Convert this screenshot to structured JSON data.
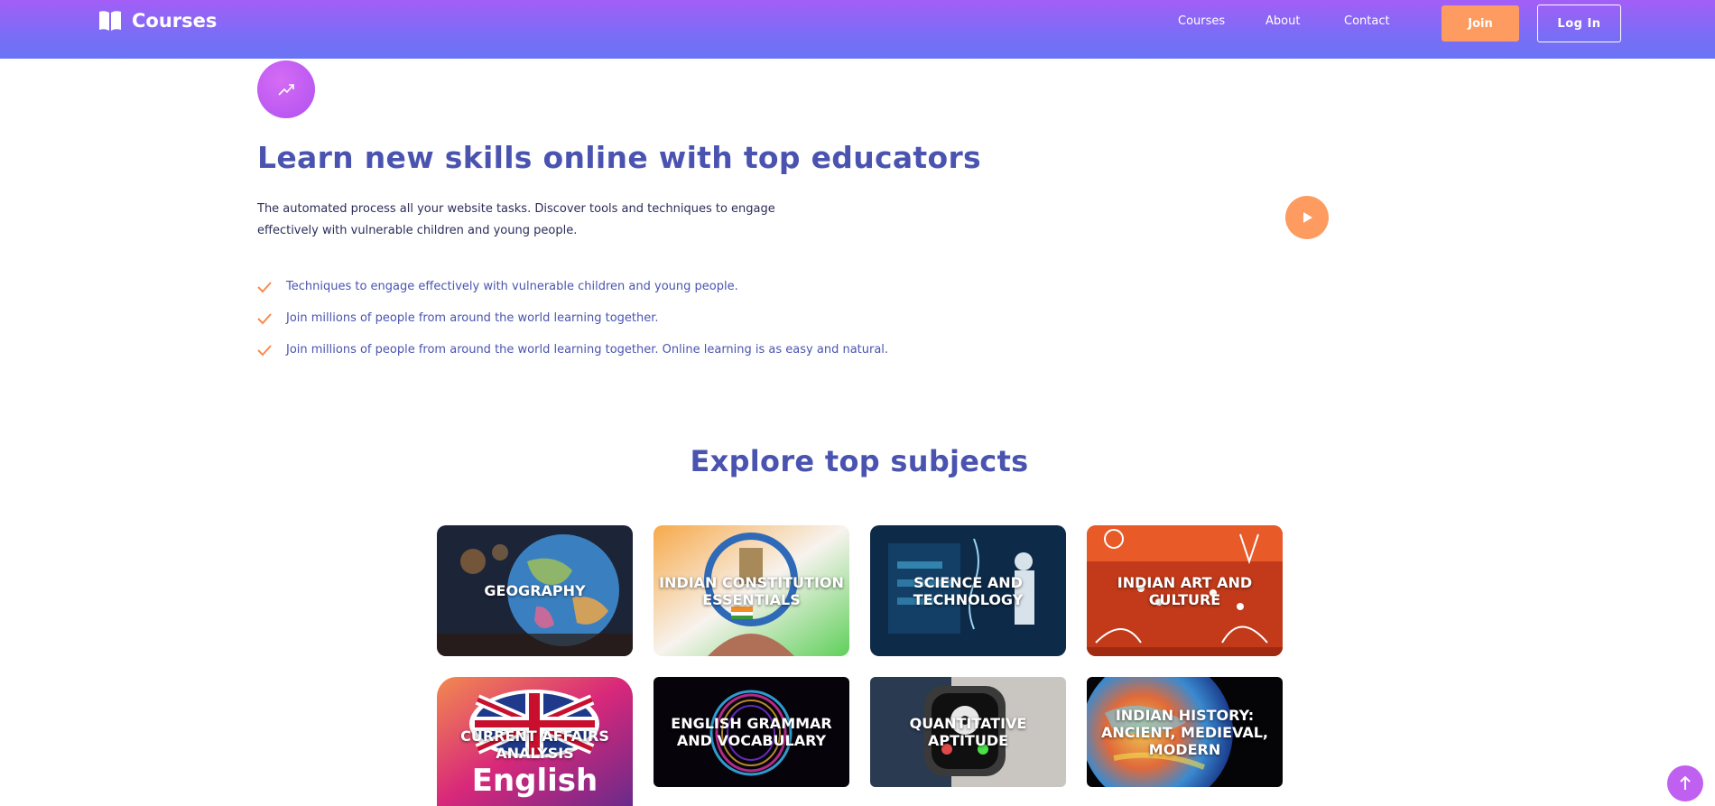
{
  "header": {
    "brand": "Courses",
    "nav": [
      {
        "label": "Courses"
      },
      {
        "label": "About"
      },
      {
        "label": "Contact"
      }
    ],
    "join_label": "Join",
    "login_label": "Log In"
  },
  "hero": {
    "title": "Learn new skills online with top educators",
    "description": "The automated process all your website tasks. Discover tools and techniques to engage effectively with vulnerable children and young people.",
    "checks": [
      "Techniques to engage effectively with vulnerable children and young people.",
      "Join millions of people from around the world learning together.",
      "Join millions of people from around the world learning together. Online learning is as easy and natural."
    ]
  },
  "subjects": {
    "title": "Explore top subjects",
    "cards": [
      {
        "label": "GEOGRAPHY"
      },
      {
        "label": "INDIAN CONSTITUTION ESSENTIALS"
      },
      {
        "label": "SCIENCE AND TECHNOLOGY"
      },
      {
        "label": "INDIAN ART AND CULTURE"
      },
      {
        "label": "CURRENT AFFAIRS ANALYSIS",
        "art_text": "English"
      },
      {
        "label": "ENGLISH GRAMMAR AND VOCABULARY"
      },
      {
        "label": "QUANTITATIVE APTITUDE"
      },
      {
        "label": "INDIAN HISTORY: ANCIENT, MEDIEVAL, MODERN"
      }
    ]
  },
  "colors": {
    "accent": "#fd9b60",
    "title": "#4a54b0",
    "header_start": "#a35ef6",
    "header_end": "#6a74f5"
  },
  "icons": {
    "brand": "book-icon",
    "badge": "trend-up-icon",
    "check": "check-icon",
    "play": "play-icon",
    "scroll_top": "arrow-up-icon"
  }
}
